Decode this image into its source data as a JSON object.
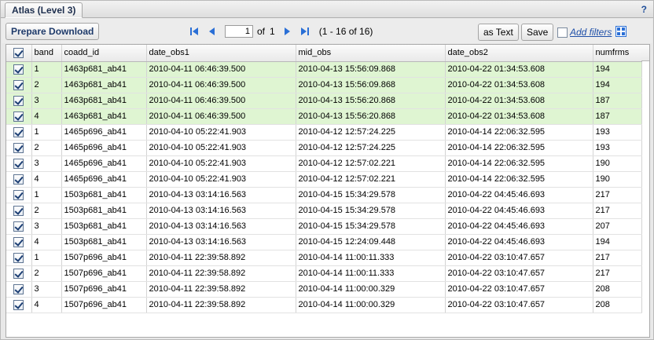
{
  "tab": {
    "title": "Atlas (Level 3)",
    "help": "?"
  },
  "toolbar": {
    "prepare_download": "Prepare Download",
    "page_value": "1",
    "of_label": "of",
    "total_pages": "1",
    "range": "(1 - 16 of 16)",
    "as_text": "as Text",
    "save": "Save",
    "add_filters": "Add filters"
  },
  "icons": {
    "first": "first-page-icon",
    "prev": "previous-page-icon",
    "next": "next-page-icon",
    "last": "last-page-icon",
    "columns": "column-select-icon",
    "nav_color": "#2a6fd6"
  },
  "colors": {
    "highlight_row": "#dff5d2",
    "link": "#1f4fa8"
  },
  "table": {
    "columns": [
      "band",
      "coadd_id",
      "date_obs1",
      "mid_obs",
      "date_obs2",
      "numfrms"
    ],
    "rows": [
      [
        "1",
        "1463p681_ab41",
        "2010-04-11 06:46:39.500",
        "2010-04-13 15:56:09.868",
        "2010-04-22 01:34:53.608",
        "194"
      ],
      [
        "2",
        "1463p681_ab41",
        "2010-04-11 06:46:39.500",
        "2010-04-13 15:56:09.868",
        "2010-04-22 01:34:53.608",
        "194"
      ],
      [
        "3",
        "1463p681_ab41",
        "2010-04-11 06:46:39.500",
        "2010-04-13 15:56:20.868",
        "2010-04-22 01:34:53.608",
        "187"
      ],
      [
        "4",
        "1463p681_ab41",
        "2010-04-11 06:46:39.500",
        "2010-04-13 15:56:20.868",
        "2010-04-22 01:34:53.608",
        "187"
      ],
      [
        "1",
        "1465p696_ab41",
        "2010-04-10 05:22:41.903",
        "2010-04-12 12:57:24.225",
        "2010-04-14 22:06:32.595",
        "193"
      ],
      [
        "2",
        "1465p696_ab41",
        "2010-04-10 05:22:41.903",
        "2010-04-12 12:57:24.225",
        "2010-04-14 22:06:32.595",
        "193"
      ],
      [
        "3",
        "1465p696_ab41",
        "2010-04-10 05:22:41.903",
        "2010-04-12 12:57:02.221",
        "2010-04-14 22:06:32.595",
        "190"
      ],
      [
        "4",
        "1465p696_ab41",
        "2010-04-10 05:22:41.903",
        "2010-04-12 12:57:02.221",
        "2010-04-14 22:06:32.595",
        "190"
      ],
      [
        "1",
        "1503p681_ab41",
        "2010-04-13 03:14:16.563",
        "2010-04-15 15:34:29.578",
        "2010-04-22 04:45:46.693",
        "217"
      ],
      [
        "2",
        "1503p681_ab41",
        "2010-04-13 03:14:16.563",
        "2010-04-15 15:34:29.578",
        "2010-04-22 04:45:46.693",
        "217"
      ],
      [
        "3",
        "1503p681_ab41",
        "2010-04-13 03:14:16.563",
        "2010-04-15 15:34:29.578",
        "2010-04-22 04:45:46.693",
        "207"
      ],
      [
        "4",
        "1503p681_ab41",
        "2010-04-13 03:14:16.563",
        "2010-04-15 12:24:09.448",
        "2010-04-22 04:45:46.693",
        "194"
      ],
      [
        "1",
        "1507p696_ab41",
        "2010-04-11 22:39:58.892",
        "2010-04-14 11:00:11.333",
        "2010-04-22 03:10:47.657",
        "217"
      ],
      [
        "2",
        "1507p696_ab41",
        "2010-04-11 22:39:58.892",
        "2010-04-14 11:00:11.333",
        "2010-04-22 03:10:47.657",
        "217"
      ],
      [
        "3",
        "1507p696_ab41",
        "2010-04-11 22:39:58.892",
        "2010-04-14 11:00:00.329",
        "2010-04-22 03:10:47.657",
        "208"
      ],
      [
        "4",
        "1507p696_ab41",
        "2010-04-11 22:39:58.892",
        "2010-04-14 11:00:00.329",
        "2010-04-22 03:10:47.657",
        "208"
      ]
    ],
    "highlighted_rows": 4
  }
}
